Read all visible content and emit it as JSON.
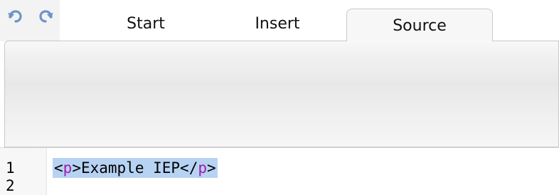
{
  "toolbar": {
    "undo_icon": "undo-icon",
    "redo_icon": "redo-icon",
    "tabs": [
      {
        "label": "Start",
        "active": false
      },
      {
        "label": "Insert",
        "active": false
      },
      {
        "label": "Source",
        "active": true
      }
    ]
  },
  "editor": {
    "line_numbers": [
      "1",
      "2"
    ],
    "code": {
      "open_bracket": "<",
      "open_tag": "p",
      "open_close_bracket": ">",
      "text": "Example IEP",
      "close_bracket": "</",
      "close_tag": "p",
      "close_end_bracket": ">"
    },
    "colors": {
      "selection": "#b7d3f3",
      "tag_name": "#a21bb0",
      "icon_blue": "#6e93c9"
    }
  }
}
